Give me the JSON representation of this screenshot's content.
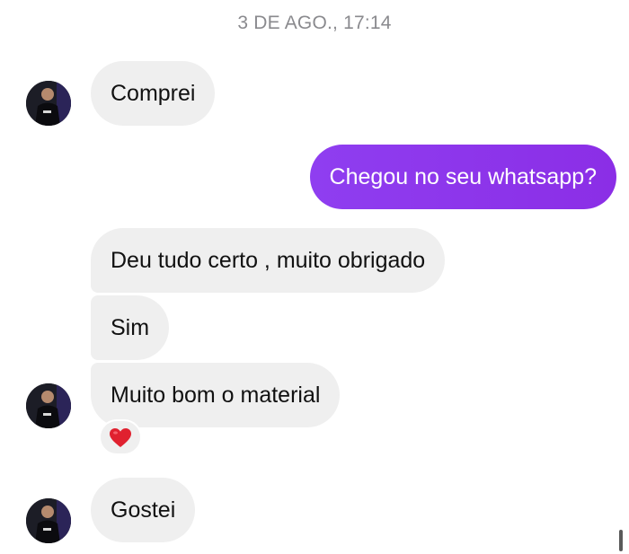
{
  "conversation": {
    "timestamp": "3 DE AGO., 17:14",
    "messages": [
      {
        "sender": "contact",
        "text": "Comprei"
      },
      {
        "sender": "me",
        "text": "Chegou no seu whatsapp?"
      },
      {
        "sender": "contact",
        "text": "Deu tudo certo , muito obrigado"
      },
      {
        "sender": "contact",
        "text": "Sim"
      },
      {
        "sender": "contact",
        "text": "Muito bom o material",
        "reaction": "heart-icon"
      },
      {
        "sender": "contact",
        "text": "Gostei"
      }
    ]
  },
  "colors": {
    "outgoing_bubble": "#8B2EE6",
    "incoming_bubble": "#EFEFEF",
    "timestamp_text": "#8A8A8E",
    "reaction_heart": "#E0212F"
  }
}
